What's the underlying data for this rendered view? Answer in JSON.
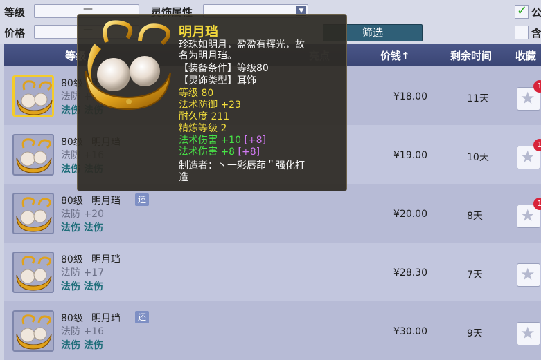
{
  "filters": {
    "level_label": "等级",
    "level_value": "—",
    "lingshi_label": "灵饰属性",
    "price_label": "价格",
    "price_value": "—",
    "filter_button": "筛选",
    "check1_label": "公",
    "check2_label": "含"
  },
  "table": {
    "col_grade": "等级",
    "col_highlight": "亮点",
    "col_price": "价钱↑",
    "col_time": "剩余时间",
    "col_fav": "收藏"
  },
  "rows": [
    {
      "level": "80级",
      "name": "明月珰",
      "stat": "法防 +16",
      "tag1": "法伤",
      "tag2": "法伤",
      "price": "¥18.00",
      "time": "11天",
      "badge": "",
      "notif": "1"
    },
    {
      "level": "80级",
      "name": "明月珰",
      "stat": "法防 +16",
      "tag1": "法伤",
      "tag2": "法伤",
      "price": "¥19.00",
      "time": "10天",
      "badge": "",
      "notif": "1"
    },
    {
      "level": "80级",
      "name": "明月珰",
      "stat": "法防 +20",
      "tag1": "法伤",
      "tag2": "法伤",
      "price": "¥20.00",
      "time": "8天",
      "badge": "还",
      "notif": "1"
    },
    {
      "level": "80级",
      "name": "明月珰",
      "stat": "法防 +17",
      "tag1": "法伤",
      "tag2": "法伤",
      "price": "¥28.30",
      "time": "7天",
      "badge": "",
      "notif": ""
    },
    {
      "level": "80级",
      "name": "明月珰",
      "stat": "法防 +16",
      "tag1": "法伤",
      "tag2": "法伤",
      "price": "¥30.00",
      "time": "9天",
      "badge": "还",
      "notif": ""
    }
  ],
  "tooltip": {
    "name": "明月珰",
    "desc1": "珍珠如明月，盈盈有辉光，故",
    "desc2": "名为明月珰。",
    "req": "【装备条件】等级80",
    "type": "【灵饰类型】耳饰",
    "level": "等级 80",
    "mdef": "法术防御 +23",
    "durability": "耐久度 211",
    "refine": "精炼等级 2",
    "attr1": "法术伤害 +10",
    "attr1_bonus": "[+8]",
    "attr2": "法术伤害 +8",
    "attr2_bonus": "[+8]",
    "maker1": "制造者：丶一彩唇茚＂强化打",
    "maker2": "造"
  },
  "colors": {
    "header": "#3f4a7b",
    "button": "#2f5f77",
    "tooltip_name": "#f2d83b",
    "tooltip_green": "#47e447",
    "tooltip_purple": "#d079f2"
  }
}
